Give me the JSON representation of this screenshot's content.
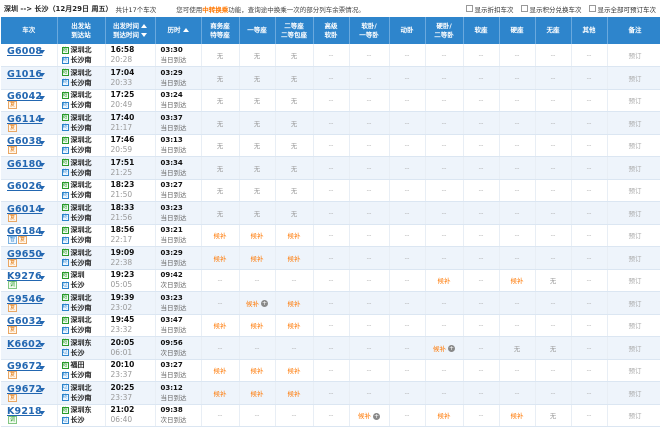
{
  "topbar": {
    "route": "深圳 --> 长沙（12月29日 周五）",
    "total": "共计17个车次",
    "notice_pre": "您可使用",
    "notice_hl": "中转换乘",
    "notice_post": "功能，查询途中换乘一次的部分列车余票情况。",
    "options": [
      "显示折扣车次",
      "显示积分兑换车次",
      "显示全部可预订车次"
    ]
  },
  "headers": {
    "train": "车次",
    "station_a": "出发站",
    "station_b": "到达站",
    "time_a": "出发时间",
    "time_b": "到达时间",
    "duration": "历时",
    "seats": [
      [
        "商务座",
        "特等座"
      ],
      [
        "一等座",
        ""
      ],
      [
        "二等座",
        "二等包座"
      ],
      [
        "高级",
        "软卧"
      ],
      [
        "软卧/",
        "一等卧"
      ],
      [
        "动卧",
        ""
      ],
      [
        "硬卧/",
        "二等卧"
      ],
      [
        "软座",
        ""
      ],
      [
        "硬座",
        ""
      ],
      [
        "无座",
        ""
      ],
      [
        "其他",
        ""
      ]
    ],
    "remark": "备注"
  },
  "rows": [
    {
      "no": "G6008",
      "tags": [],
      "from": "深圳北",
      "to": "长沙南",
      "fmark": "始",
      "tmark": "终",
      "dep": "16:58",
      "arr": "20:28",
      "dur": "03:30",
      "day": "当日到达",
      "seats": [
        "无",
        "无",
        "无",
        "--",
        "--",
        "--",
        "--",
        "--",
        "--",
        "--",
        "--"
      ]
    },
    {
      "no": "G1016",
      "tags": [],
      "from": "深圳北",
      "to": "长沙南",
      "fmark": "始",
      "tmark": "终",
      "dep": "17:04",
      "arr": "20:33",
      "dur": "03:29",
      "day": "当日到达",
      "seats": [
        "无",
        "无",
        "无",
        "--",
        "--",
        "--",
        "--",
        "--",
        "--",
        "--",
        "--"
      ]
    },
    {
      "no": "G6042",
      "tags": [
        "复"
      ],
      "from": "深圳北",
      "to": "长沙南",
      "fmark": "始",
      "tmark": "终",
      "dep": "17:25",
      "arr": "20:49",
      "dur": "03:24",
      "day": "当日到达",
      "seats": [
        "无",
        "无",
        "无",
        "--",
        "--",
        "--",
        "--",
        "--",
        "--",
        "--",
        "--"
      ]
    },
    {
      "no": "G6114",
      "tags": [
        "复"
      ],
      "from": "深圳北",
      "to": "长沙南",
      "fmark": "始",
      "tmark": "终",
      "dep": "17:40",
      "arr": "21:17",
      "dur": "03:37",
      "day": "当日到达",
      "seats": [
        "无",
        "无",
        "无",
        "--",
        "--",
        "--",
        "--",
        "--",
        "--",
        "--",
        "--"
      ]
    },
    {
      "no": "G6038",
      "tags": [
        "复"
      ],
      "from": "深圳北",
      "to": "长沙南",
      "fmark": "始",
      "tmark": "终",
      "dep": "17:46",
      "arr": "20:59",
      "dur": "03:13",
      "day": "当日到达",
      "seats": [
        "无",
        "无",
        "无",
        "--",
        "--",
        "--",
        "--",
        "--",
        "--",
        "--",
        "--"
      ]
    },
    {
      "no": "G6180",
      "tags": [],
      "from": "深圳北",
      "to": "长沙南",
      "fmark": "始",
      "tmark": "终",
      "dep": "17:51",
      "arr": "21:25",
      "dur": "03:34",
      "day": "当日到达",
      "seats": [
        "无",
        "无",
        "无",
        "--",
        "--",
        "--",
        "--",
        "--",
        "--",
        "--",
        "--"
      ]
    },
    {
      "no": "G6026",
      "tags": [],
      "from": "深圳北",
      "to": "长沙南",
      "fmark": "始",
      "tmark": "终",
      "dep": "18:23",
      "arr": "21:50",
      "dur": "03:27",
      "day": "当日到达",
      "seats": [
        "无",
        "无",
        "无",
        "--",
        "--",
        "--",
        "--",
        "--",
        "--",
        "--",
        "--"
      ]
    },
    {
      "no": "G6014",
      "tags": [
        "复"
      ],
      "from": "深圳北",
      "to": "长沙南",
      "fmark": "始",
      "tmark": "终",
      "dep": "18:33",
      "arr": "21:56",
      "dur": "03:23",
      "day": "当日到达",
      "seats": [
        "无",
        "无",
        "无",
        "--",
        "--",
        "--",
        "--",
        "--",
        "--",
        "--",
        "--"
      ]
    },
    {
      "no": "G6184",
      "tags": [
        "智",
        "复"
      ],
      "from": "深圳北",
      "to": "长沙南",
      "fmark": "始",
      "tmark": "终",
      "dep": "18:56",
      "arr": "22:17",
      "dur": "03:21",
      "day": "当日到达",
      "seats": [
        "候补",
        "候补",
        "候补",
        "--",
        "--",
        "--",
        "--",
        "--",
        "--",
        "--",
        "--"
      ]
    },
    {
      "no": "G9650",
      "tags": [
        "复"
      ],
      "from": "深圳北",
      "to": "长沙南",
      "fmark": "始",
      "tmark": "终",
      "dep": "19:09",
      "arr": "22:38",
      "dur": "03:29",
      "day": "当日到达",
      "seats": [
        "候补",
        "候补",
        "候补",
        "--",
        "--",
        "--",
        "--",
        "--",
        "--",
        "--",
        "--"
      ]
    },
    {
      "no": "K9276",
      "tags": [
        "调"
      ],
      "from": "深圳",
      "to": "长沙",
      "fmark": "始",
      "tmark": "过",
      "dep": "19:23",
      "arr": "05:05",
      "dur": "09:42",
      "day": "次日到达",
      "seats": [
        "--",
        "--",
        "--",
        "--",
        "--",
        "--",
        "候补",
        "--",
        "候补",
        "无",
        "--"
      ]
    },
    {
      "no": "G9546",
      "tags": [
        "复"
      ],
      "from": "深圳北",
      "to": "长沙南",
      "fmark": "始",
      "tmark": "终",
      "dep": "19:39",
      "arr": "23:02",
      "dur": "03:23",
      "day": "当日到达",
      "seats": [
        "--",
        "候补+",
        "候补",
        "--",
        "--",
        "--",
        "--",
        "--",
        "--",
        "--",
        "--"
      ]
    },
    {
      "no": "G6032",
      "tags": [
        "复"
      ],
      "from": "深圳北",
      "to": "长沙南",
      "fmark": "始",
      "tmark": "终",
      "dep": "19:45",
      "arr": "23:32",
      "dur": "03:47",
      "day": "当日到达",
      "seats": [
        "候补",
        "候补",
        "候补",
        "--",
        "--",
        "--",
        "--",
        "--",
        "--",
        "--",
        "--"
      ]
    },
    {
      "no": "K6602",
      "tags": [],
      "from": "深圳东",
      "to": "长沙",
      "fmark": "始",
      "tmark": "过",
      "dep": "20:05",
      "arr": "06:01",
      "dur": "09:56",
      "day": "次日到达",
      "seats": [
        "--",
        "--",
        "--",
        "--",
        "--",
        "--",
        "候补+",
        "--",
        "无",
        "无",
        "--"
      ]
    },
    {
      "no": "G9672",
      "tags": [
        "复"
      ],
      "from": "福田",
      "to": "长沙南",
      "fmark": "始",
      "tmark": "终",
      "dep": "20:10",
      "arr": "23:37",
      "dur": "03:27",
      "day": "当日到达",
      "seats": [
        "候补",
        "候补",
        "候补",
        "--",
        "--",
        "--",
        "--",
        "--",
        "--",
        "--",
        "--"
      ]
    },
    {
      "no": "G9672",
      "tags": [
        "复"
      ],
      "from": "深圳北",
      "to": "长沙南",
      "fmark": "过",
      "tmark": "终",
      "dep": "20:25",
      "arr": "23:37",
      "dur": "03:12",
      "day": "当日到达",
      "seats": [
        "候补",
        "候补",
        "候补",
        "--",
        "--",
        "--",
        "--",
        "--",
        "--",
        "--",
        "--"
      ]
    },
    {
      "no": "K9218",
      "tags": [
        "调"
      ],
      "from": "深圳东",
      "to": "长沙",
      "fmark": "始",
      "tmark": "过",
      "dep": "21:02",
      "arr": "06:40",
      "dur": "09:38",
      "day": "次日到达",
      "seats": [
        "--",
        "--",
        "--",
        "--",
        "候补+",
        "--",
        "候补",
        "--",
        "候补",
        "无",
        "--"
      ]
    }
  ],
  "book_label": "预订",
  "colors": {
    "header": "#2e85cc",
    "train_link": "#2367b1",
    "hb": "#ff7700"
  }
}
